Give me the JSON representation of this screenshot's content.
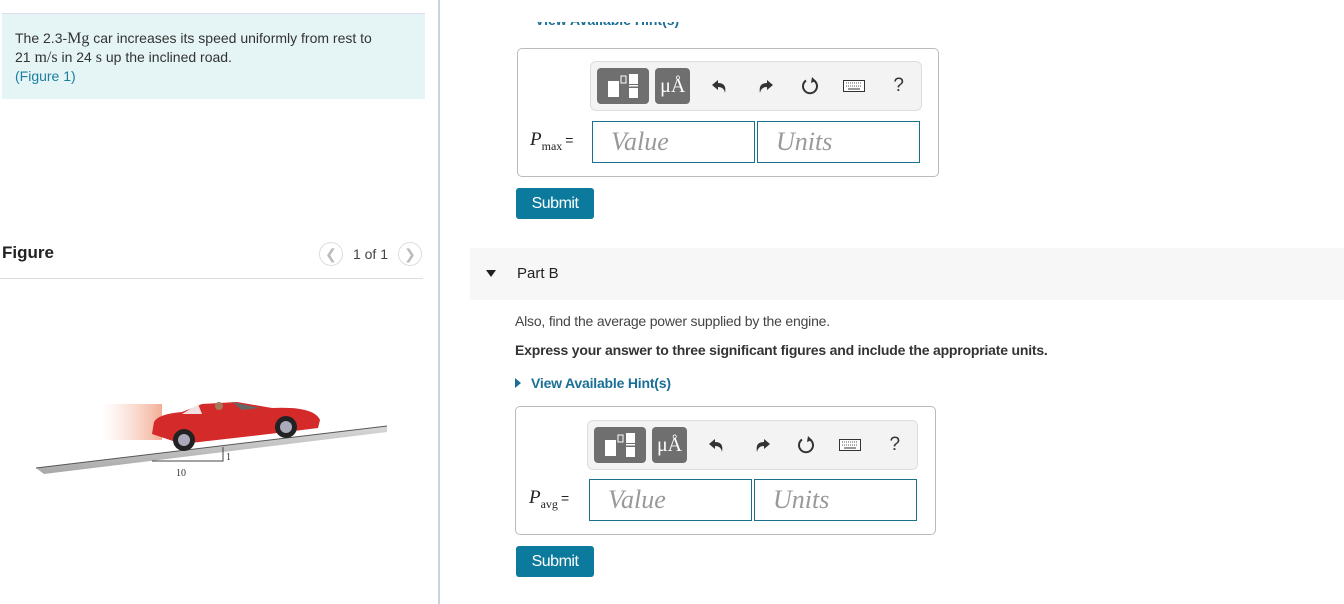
{
  "problem": {
    "text_parts": [
      "The 2.3-",
      "Mg",
      " car increases its speed uniformly from rest to"
    ],
    "line2_parts": [
      "21 ",
      "m/s",
      " in 24 ",
      "s",
      " up the inclined road."
    ],
    "figure_link": "(Figure 1)"
  },
  "figure": {
    "title": "Figure",
    "pager_text": "1 of 1",
    "prev_icon": "chevron-left-icon",
    "next_icon": "chevron-right-icon",
    "slope_rise": "1",
    "slope_run": "10",
    "car_color": "#d42a2a"
  },
  "part_a": {
    "cut_hint_label": "View Available Hint(s)",
    "variable": "P",
    "subscript": "max",
    "equals": "=",
    "value_placeholder": "Value",
    "units_placeholder": "Units",
    "submit_label": "Submit"
  },
  "part_b": {
    "title": "Part B",
    "question": "Also, find the average power supplied by the engine.",
    "instruction": "Express your answer to three significant figures and include the appropriate units.",
    "hint_label": "View Available Hint(s)",
    "variable": "P",
    "subscript": "avg",
    "equals": "=",
    "value_placeholder": "Value",
    "units_placeholder": "Units",
    "submit_label": "Submit"
  },
  "toolbar": {
    "templates_icon": "fraction-template-icon",
    "symbols_label": "μÅ",
    "undo_icon": "undo-icon",
    "redo_icon": "redo-icon",
    "reset_icon": "reset-icon",
    "keyboard_icon": "keyboard-icon",
    "help_label": "?"
  },
  "colors": {
    "accent": "#0c7a9c",
    "link": "#1a7fa0",
    "problem_bg": "#e5f4f5"
  }
}
